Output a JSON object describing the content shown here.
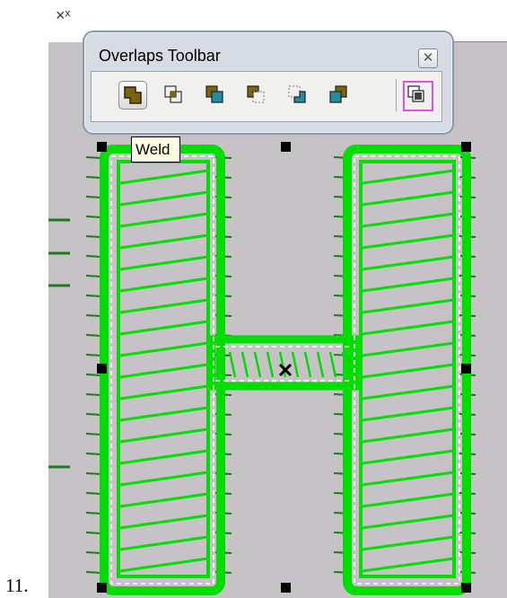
{
  "list_number": "11.",
  "toolbar": {
    "title": "Overlaps Toolbar",
    "close_glyph": "✕",
    "buttons": [
      {
        "name": "weld-button",
        "icon": "weld-icon",
        "active": true
      },
      {
        "name": "intersect-button",
        "icon": "intersect-icon",
        "active": false
      },
      {
        "name": "trim-back-button",
        "icon": "trim-back-icon",
        "active": false
      },
      {
        "name": "trim-front-button",
        "icon": "trim-front-icon",
        "active": false
      },
      {
        "name": "exclude-button",
        "icon": "exclude-icon",
        "active": false
      },
      {
        "name": "combine-button",
        "icon": "combine-icon",
        "active": false
      },
      {
        "name": "overlap-options-button",
        "icon": "overlap-options-icon",
        "active": false
      }
    ]
  },
  "tooltip": {
    "text": "Weld"
  },
  "corner_glyph": "×ˣ",
  "colors": {
    "stitch_green": "#00dd00",
    "canvas_bg": "#c6c3c6",
    "handle": "#000000",
    "highlight": "#e84de8"
  }
}
